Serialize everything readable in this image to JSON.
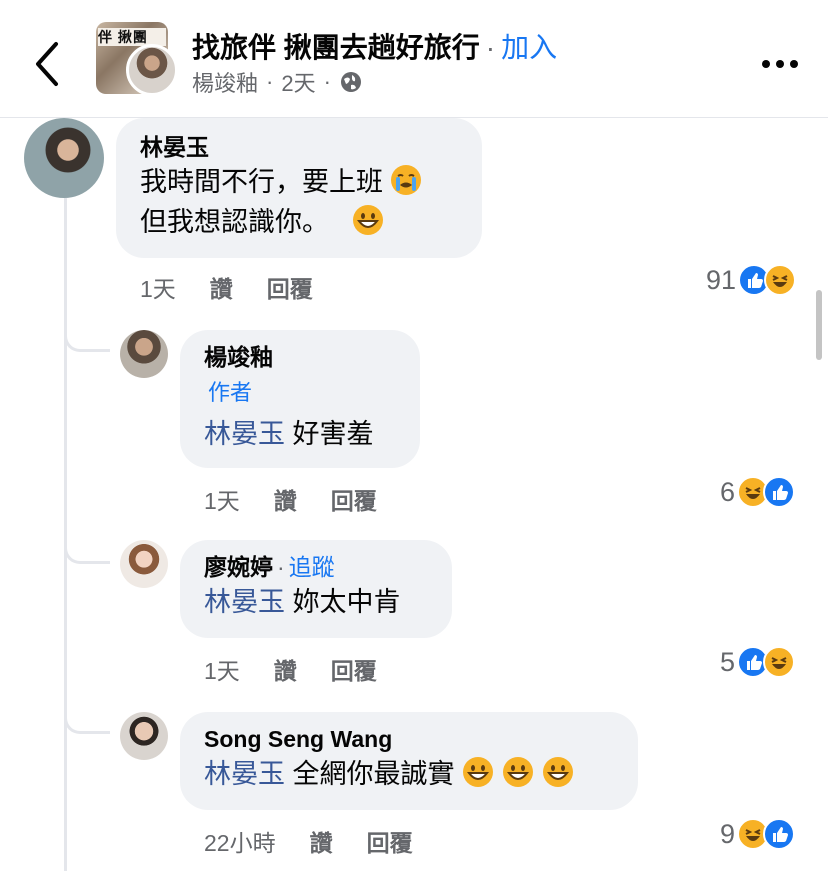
{
  "header": {
    "group_name": "找旅伴 揪團去趟好旅行",
    "dot": "·",
    "join_label": "加入",
    "author": "楊竣釉",
    "time": "2天",
    "group_thumb_text": "伴 揪團"
  },
  "comments": [
    {
      "name": "林晏玉",
      "lines": [
        "我時間不行，要上班",
        "但我想認識你。"
      ],
      "time": "1天",
      "like_label": "讚",
      "reply_label": "回覆",
      "reaction_count": "91",
      "reactions": [
        "like-icon",
        "haha-icon"
      ]
    },
    {
      "name": "楊竣釉",
      "author_badge": "作者",
      "mention": "林晏玉",
      "text": "好害羞",
      "time": "1天",
      "like_label": "讚",
      "reply_label": "回覆",
      "reaction_count": "6",
      "reactions": [
        "haha-icon",
        "like-icon"
      ]
    },
    {
      "name": "廖婉婷",
      "follow_label": "追蹤",
      "mention": "林晏玉",
      "text": "妳太中肯",
      "time": "1天",
      "like_label": "讚",
      "reply_label": "回覆",
      "reaction_count": "5",
      "reactions": [
        "like-icon",
        "haha-icon"
      ]
    },
    {
      "name": "Song Seng Wang",
      "mention": "林晏玉",
      "text": "全網你最誠實",
      "time": "22小時",
      "like_label": "讚",
      "reply_label": "回覆",
      "reaction_count": "9",
      "reactions": [
        "haha-icon",
        "like-icon"
      ]
    }
  ],
  "colors": {
    "accent": "#1877f2",
    "bubble": "#f0f2f5",
    "muted": "#65676b",
    "mention": "#385898"
  }
}
